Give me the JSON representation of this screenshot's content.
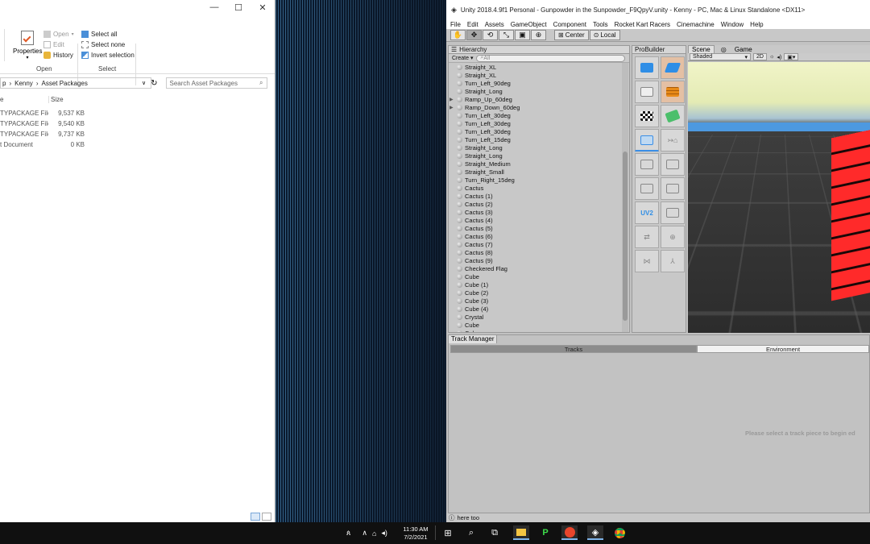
{
  "explorer": {
    "window_controls": [
      "—",
      "☐",
      "✕"
    ],
    "ribbon": {
      "open_group": {
        "properties_label": "Properties",
        "open_label": "Open",
        "edit_label": "Edit",
        "history_label": "History",
        "group_label": "Open"
      },
      "select_group": {
        "select_all": "Select all",
        "select_none": "Select none",
        "invert_selection": "Invert selection",
        "group_label": "Select"
      }
    },
    "breadcrumb": [
      "p",
      "Kenny",
      "Asset Packages"
    ],
    "search_placeholder": "Search Asset Packages",
    "columns": {
      "type": "e",
      "size": "Size"
    },
    "files": [
      {
        "type": "TYPACKAGE File",
        "size": "9,537 KB"
      },
      {
        "type": "TYPACKAGE File",
        "size": "9,540 KB"
      },
      {
        "type": "TYPACKAGE File",
        "size": "9,737 KB"
      },
      {
        "type": "t Document",
        "size": "0 KB"
      }
    ]
  },
  "unity": {
    "title": "Unity 2018.4.9f1 Personal - Gunpowder in the Sunpowder_F9QpyV.unity - Kenny - PC, Mac & Linux Standalone <DX11>",
    "menu": [
      "File",
      "Edit",
      "Assets",
      "GameObject",
      "Component",
      "Tools",
      "Rocket Kart Racers",
      "Cinemachine",
      "Window",
      "Help"
    ],
    "toolbar": {
      "center_label": "Center",
      "local_label": "Local"
    },
    "hierarchy": {
      "tab_label": "Hierarchy",
      "create_label": "Create",
      "search_placeholder": "All",
      "items": [
        {
          "name": "Straight_XL",
          "expandable": false
        },
        {
          "name": "Straight_XL",
          "expandable": false
        },
        {
          "name": "Turn_Left_90deg",
          "expandable": false
        },
        {
          "name": "Straight_Long",
          "expandable": false
        },
        {
          "name": "Ramp_Up_60deg",
          "expandable": true
        },
        {
          "name": "Ramp_Down_60deg",
          "expandable": true
        },
        {
          "name": "Turn_Left_30deg",
          "expandable": false
        },
        {
          "name": "Turn_Left_30deg",
          "expandable": false
        },
        {
          "name": "Turn_Left_30deg",
          "expandable": false
        },
        {
          "name": "Turn_Left_15deg",
          "expandable": false
        },
        {
          "name": "Straight_Long",
          "expandable": false
        },
        {
          "name": "Straight_Long",
          "expandable": false
        },
        {
          "name": "Straight_Medium",
          "expandable": false
        },
        {
          "name": "Straight_Small",
          "expandable": false
        },
        {
          "name": "Turn_Right_15deg",
          "expandable": false
        },
        {
          "name": "Cactus",
          "expandable": false
        },
        {
          "name": "Cactus (1)",
          "expandable": false
        },
        {
          "name": "Cactus (2)",
          "expandable": false
        },
        {
          "name": "Cactus (3)",
          "expandable": false
        },
        {
          "name": "Cactus (4)",
          "expandable": false
        },
        {
          "name": "Cactus (5)",
          "expandable": false
        },
        {
          "name": "Cactus (6)",
          "expandable": false
        },
        {
          "name": "Cactus (7)",
          "expandable": false
        },
        {
          "name": "Cactus (8)",
          "expandable": false
        },
        {
          "name": "Cactus (9)",
          "expandable": false
        },
        {
          "name": "Checkered Flag",
          "expandable": false
        },
        {
          "name": "Cube",
          "expandable": false
        },
        {
          "name": "Cube (1)",
          "expandable": false
        },
        {
          "name": "Cube (2)",
          "expandable": false
        },
        {
          "name": "Cube (3)",
          "expandable": false
        },
        {
          "name": "Cube (4)",
          "expandable": false
        },
        {
          "name": "Crystal",
          "expandable": false
        },
        {
          "name": "Cube",
          "expandable": false
        },
        {
          "name": "Cube",
          "expandable": false
        }
      ]
    },
    "probuilder": {
      "tab_label": "ProBuilder",
      "uv_label": "UV2"
    },
    "scene": {
      "tabs": [
        "Scene",
        "Game"
      ],
      "shading_mode": "Shaded",
      "mode_2d": "2D"
    },
    "track_manager": {
      "tab_label": "Track Manager",
      "tabs": [
        "Tracks",
        "Environment"
      ],
      "message": "Please select a track piece to begin ed"
    },
    "status_text": "here too"
  },
  "taskbar": {
    "clock_time": "11:30 AM",
    "clock_date": "7/2/2021"
  },
  "colors": {
    "unity_bg": "#c2c2c2",
    "scene_red": "#ff2a2a",
    "scene_blue": "#4d99e0",
    "taskbar_bg": "#101010"
  }
}
